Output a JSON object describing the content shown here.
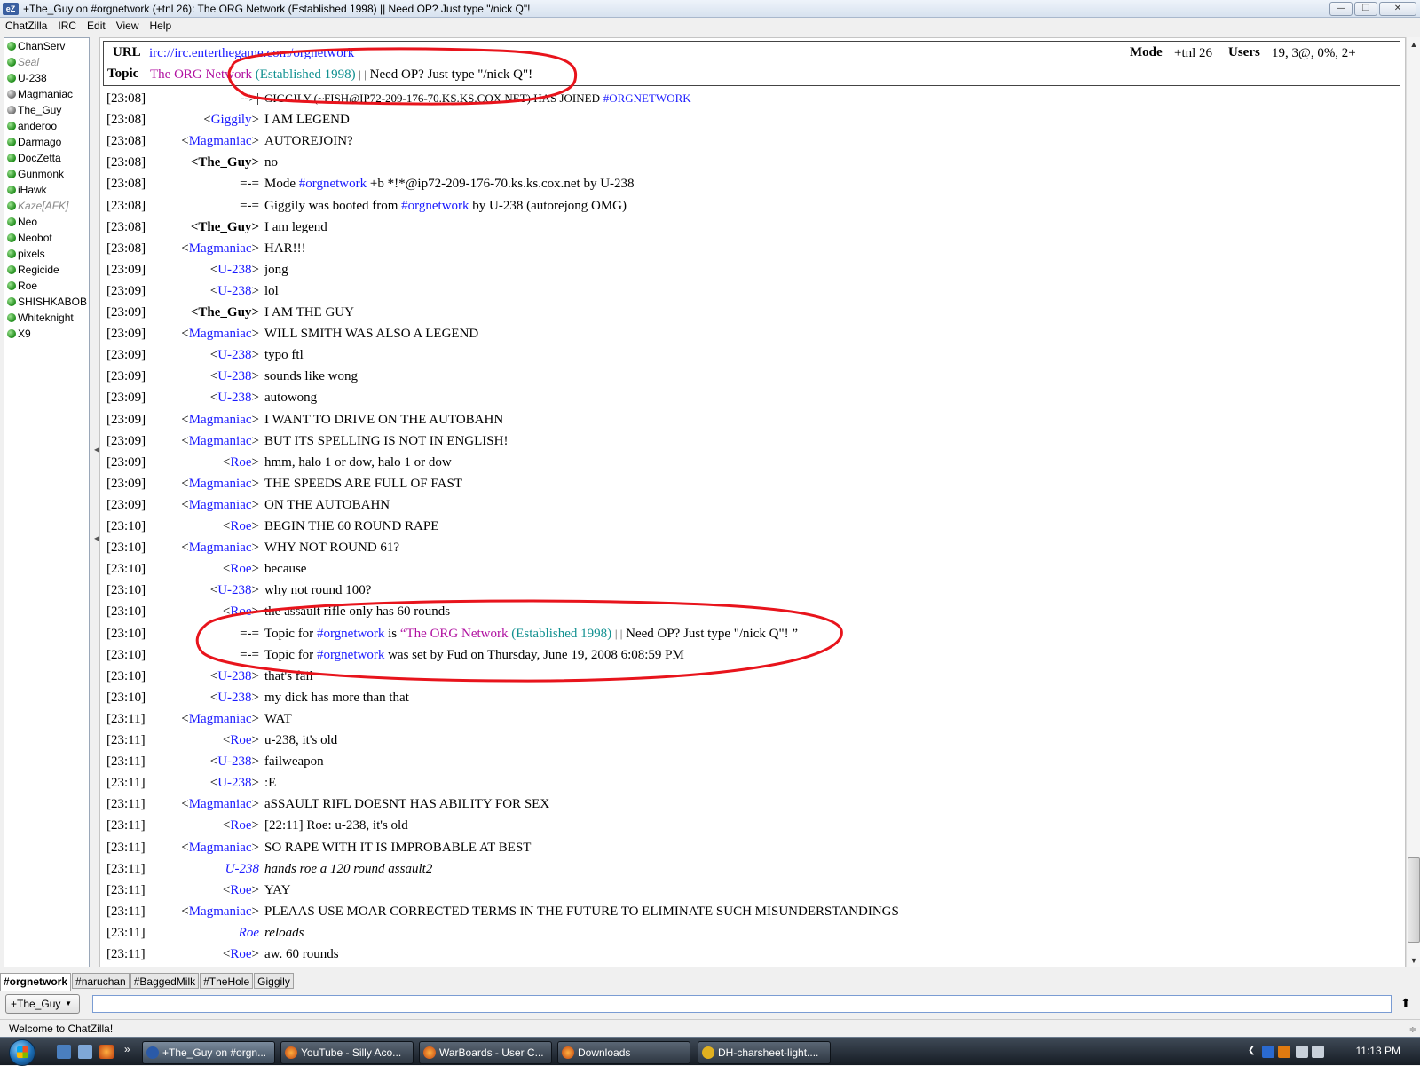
{
  "window": {
    "title": "+The_Guy on #orgnetwork (+tnl 26): The ORG Network (Established 1998) || Need OP? Just type \"/nick Q\"!",
    "app_icon": "eZ"
  },
  "menu": [
    "ChatZilla",
    "IRC",
    "Edit",
    "View",
    "Help"
  ],
  "userlist": [
    {
      "name": "ChanServ",
      "status": "green"
    },
    {
      "name": "Seal",
      "status": "away"
    },
    {
      "name": "U-238",
      "status": "green"
    },
    {
      "name": "Magmaniac",
      "status": "gray"
    },
    {
      "name": "The_Guy",
      "status": "gray"
    },
    {
      "name": "anderoo",
      "status": "green"
    },
    {
      "name": "Darmago",
      "status": "green"
    },
    {
      "name": "DocZetta",
      "status": "green"
    },
    {
      "name": "Gunmonk",
      "status": "green"
    },
    {
      "name": "iHawk",
      "status": "green"
    },
    {
      "name": "Kaze[AFK]",
      "status": "away"
    },
    {
      "name": "Neo",
      "status": "green"
    },
    {
      "name": "Neobot",
      "status": "green"
    },
    {
      "name": "pixels",
      "status": "green"
    },
    {
      "name": "Regicide",
      "status": "green"
    },
    {
      "name": "Roe",
      "status": "green"
    },
    {
      "name": "SHISHKABOB",
      "status": "green"
    },
    {
      "name": "Whiteknight",
      "status": "green"
    },
    {
      "name": "X9",
      "status": "green"
    }
  ],
  "header": {
    "url_label": "URL",
    "url": "irc://irc.enterthegame.com/orgnetwork",
    "mode_label": "Mode",
    "mode": "+tnl 26",
    "users_label": "Users",
    "users": "19, 3@, 0%, 2+",
    "topic_label": "Topic",
    "topic_part1": "The ORG Network",
    "topic_part2": "(Established 1998)",
    "topic_part3": "| |",
    "topic_part4": "Need OP? Just type \"/nick Q\"!"
  },
  "messages": [
    {
      "ts": "[23:08]",
      "nick": "-->|",
      "type": "join",
      "text": "GIGGILY (~FISH@IP72-209-176-70.KS.KS.COX.NET) HAS JOINED",
      "chan": "#ORGNETWORK"
    },
    {
      "ts": "[23:08]",
      "nick": "Giggily",
      "type": "msg",
      "text": "I AM LEGEND"
    },
    {
      "ts": "[23:08]",
      "nick": "Magmaniac",
      "type": "msg",
      "text": "AUTOREJOIN?"
    },
    {
      "ts": "[23:08]",
      "nick": "The_Guy",
      "type": "self",
      "text": "no"
    },
    {
      "ts": "[23:08]",
      "nick": "=-=",
      "type": "sys",
      "pre": "Mode",
      "chan": "#orgnetwork",
      "text": "+b *!*@ip72-209-176-70.ks.ks.cox.net by U-238"
    },
    {
      "ts": "[23:08]",
      "nick": "=-=",
      "type": "sys",
      "pre": "Giggily was booted from",
      "chan": "#orgnetwork",
      "text": "by U-238 (autorejong OMG)"
    },
    {
      "ts": "[23:08]",
      "nick": "The_Guy",
      "type": "self",
      "text": "I am legend"
    },
    {
      "ts": "[23:08]",
      "nick": "Magmaniac",
      "type": "msg",
      "text": "HAR!!!"
    },
    {
      "ts": "[23:09]",
      "nick": "U-238",
      "type": "msg",
      "text": "jong"
    },
    {
      "ts": "[23:09]",
      "nick": "U-238",
      "type": "msg",
      "text": "lol"
    },
    {
      "ts": "[23:09]",
      "nick": "The_Guy",
      "type": "self",
      "text": "I AM THE GUY"
    },
    {
      "ts": "[23:09]",
      "nick": "Magmaniac",
      "type": "msg",
      "text": "WILL SMITH WAS ALSO A LEGEND"
    },
    {
      "ts": "[23:09]",
      "nick": "U-238",
      "type": "msg",
      "text": "typo ftl"
    },
    {
      "ts": "[23:09]",
      "nick": "U-238",
      "type": "msg",
      "text": "sounds like wong"
    },
    {
      "ts": "[23:09]",
      "nick": "U-238",
      "type": "msg",
      "text": "autowong"
    },
    {
      "ts": "[23:09]",
      "nick": "Magmaniac",
      "type": "msg",
      "text": "I WANT TO DRIVE ON THE AUTOBAHN"
    },
    {
      "ts": "[23:09]",
      "nick": "Magmaniac",
      "type": "msg",
      "text": "BUT ITS SPELLING IS NOT IN ENGLISH!"
    },
    {
      "ts": "[23:09]",
      "nick": "Roe",
      "type": "msg",
      "text": "hmm, halo 1 or dow, halo 1 or dow"
    },
    {
      "ts": "[23:09]",
      "nick": "Magmaniac",
      "type": "msg",
      "text": "THE SPEEDS ARE FULL OF FAST"
    },
    {
      "ts": "[23:09]",
      "nick": "Magmaniac",
      "type": "msg",
      "text": "ON THE AUTOBAHN"
    },
    {
      "ts": "[23:10]",
      "nick": "Roe",
      "type": "msg",
      "text": "BEGIN THE 60 ROUND RAPE"
    },
    {
      "ts": "[23:10]",
      "nick": "Magmaniac",
      "type": "msg",
      "text": "WHY NOT ROUND 61?"
    },
    {
      "ts": "[23:10]",
      "nick": "Roe",
      "type": "msg",
      "text": "because"
    },
    {
      "ts": "[23:10]",
      "nick": "U-238",
      "type": "msg",
      "text": "why not round 100?"
    },
    {
      "ts": "[23:10]",
      "nick": "Roe",
      "type": "msg",
      "text": "the assault rifle only has 60 rounds"
    },
    {
      "ts": "[23:10]",
      "nick": "=-=",
      "type": "topic",
      "pre": "Topic for",
      "chan": "#orgnetwork",
      "mid": "is",
      "t1": "“The ORG Network",
      "t2": "(Established 1998)",
      "t3": "| |",
      "t4": "Need OP? Just type \"/nick Q\"! ”"
    },
    {
      "ts": "[23:10]",
      "nick": "=-=",
      "type": "sys",
      "pre": "Topic for",
      "chan": "#orgnetwork",
      "text": "was set by Fud on Thursday, June 19, 2008 6:08:59 PM"
    },
    {
      "ts": "[23:10]",
      "nick": "U-238",
      "type": "msg",
      "text": "that's fail"
    },
    {
      "ts": "[23:10]",
      "nick": "U-238",
      "type": "msg",
      "text": "my dick has more than that"
    },
    {
      "ts": "[23:11]",
      "nick": "Magmaniac",
      "type": "msg",
      "text": "WAT"
    },
    {
      "ts": "[23:11]",
      "nick": "Roe",
      "type": "msg",
      "text": "u-238, it's old"
    },
    {
      "ts": "[23:11]",
      "nick": "U-238",
      "type": "msg",
      "text": "failweapon"
    },
    {
      "ts": "[23:11]",
      "nick": "U-238",
      "type": "msg",
      "text": ":E"
    },
    {
      "ts": "[23:11]",
      "nick": "Magmaniac",
      "type": "msg",
      "text": "aSSAULT RIFL DOESNT HAS ABILITY FOR SEX"
    },
    {
      "ts": "[23:11]",
      "nick": "Roe",
      "type": "msg",
      "text": "[22:11] Roe: u-238, it's old"
    },
    {
      "ts": "[23:11]",
      "nick": "Magmaniac",
      "type": "msg",
      "text": "SO RAPE WITH IT IS IMPROBABLE AT BEST"
    },
    {
      "ts": "[23:11]",
      "nick": "U-238",
      "type": "action",
      "text": "hands roe a 120 round assault2"
    },
    {
      "ts": "[23:11]",
      "nick": "Roe",
      "type": "msg",
      "text": "YAY"
    },
    {
      "ts": "[23:11]",
      "nick": "Magmaniac",
      "type": "msg",
      "text": "PLEAAS USE MOAR CORRECTED TERMS IN THE FUTURE TO ELIMINATE SUCH MISUNDERSTANDINGS"
    },
    {
      "ts": "[23:11]",
      "nick": "Roe",
      "type": "action",
      "text": "reloads"
    },
    {
      "ts": "[23:11]",
      "nick": "Roe",
      "type": "msg",
      "text": "aw. 60 rounds"
    }
  ],
  "tabs": [
    "#orgnetwork",
    "#naruchan",
    "#BaggedMilk",
    "#TheHole",
    "Giggily"
  ],
  "input": {
    "nick": "+The_Guy",
    "value": ""
  },
  "status": "Welcome to ChatZilla!",
  "taskbar": {
    "buttons": [
      "+The_Guy on #orgn...",
      "YouTube - Silly Aco...",
      "WarBoards - User C...",
      "Downloads",
      "DH-charsheet-light...."
    ],
    "clock": "11:13 PM"
  },
  "colors": {
    "nick_blue": "#1a1aff",
    "topic_magenta": "#b010a0",
    "topic_teal": "#109090",
    "annotation_red": "#e8141c"
  }
}
